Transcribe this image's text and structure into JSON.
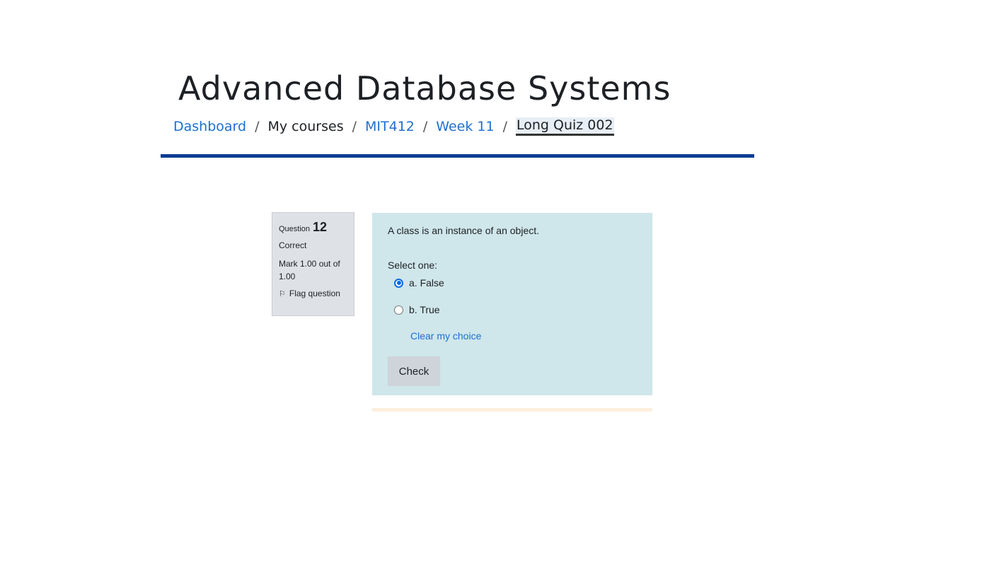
{
  "header": {
    "course_title": "Advanced Database Systems",
    "breadcrumb": {
      "dashboard": "Dashboard",
      "my_courses": "My courses",
      "course": "MIT412",
      "week": "Week 11",
      "current": "Long Quiz 002",
      "separator": "/"
    },
    "accent_color": "#0b3d91"
  },
  "question_info": {
    "label": "Question",
    "number": "12",
    "state": "Correct",
    "grade": "Mark 1.00 out of 1.00",
    "flag_label": "Flag question"
  },
  "question": {
    "text": "A class is an instance of an object.",
    "prompt": "Select one:",
    "options": [
      {
        "label": "a. False",
        "selected": true
      },
      {
        "label": "b. True",
        "selected": false
      }
    ],
    "clear_label": "Clear my choice",
    "check_label": "Check",
    "background_color": "#cfe6ea"
  }
}
